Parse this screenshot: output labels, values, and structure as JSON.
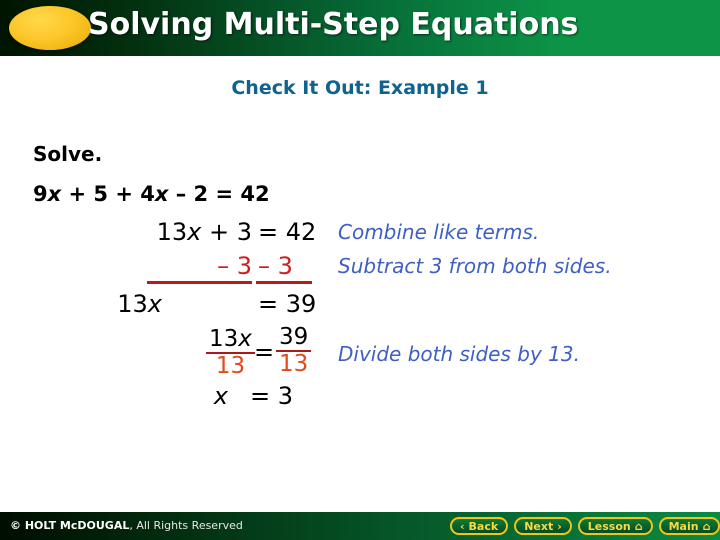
{
  "header": {
    "title": "Solving Multi-Step Equations",
    "ellipse_color": "#fcc72a",
    "gradient_from": "#001400",
    "gradient_to": "#0d9447"
  },
  "subtitle": "Check It Out: Example 1",
  "prompt": "Solve.",
  "equation_lines": [
    {
      "lhs": "9x + 5 + 4x – 2",
      "eq": "=",
      "rhs": "42",
      "note": ""
    },
    {
      "lhs": "13x + 3",
      "eq": "=",
      "rhs": "42",
      "note": "Combine like terms."
    },
    {
      "lhs": "– 3",
      "eq": "",
      "rhs": "– 3",
      "note": "Subtract 3 from both sides."
    },
    {
      "lhs": "13x",
      "eq": "=",
      "rhs": "39",
      "note": ""
    },
    {
      "lhs_num": "13x",
      "lhs_den": "13",
      "eq": "=",
      "rhs_num": "39",
      "rhs_den": "13",
      "note": "Divide both sides by 13."
    },
    {
      "lhs": "x",
      "eq": "=",
      "rhs": "3",
      "note": ""
    }
  ],
  "line1": {
    "a": "9",
    "x1": "x",
    "b": " + 5 + ",
    "c": "4",
    "x2": "x",
    "d": " – 2 = 42"
  },
  "line2": {
    "a": "13",
    "x1": "x",
    "b": " + 3",
    "eq": "= 42"
  },
  "line3": {
    "left": "– 3",
    "right": "– 3"
  },
  "line4": {
    "a": "13",
    "x1": "x",
    "eq": "= 39"
  },
  "line5": {
    "num_a": "13",
    "num_x": "x",
    "den": "13",
    "eq": "=",
    "rnum": "39",
    "rden": "13"
  },
  "line6": {
    "x": "x",
    "eq": "= 3"
  },
  "notes": {
    "combine": "Combine like terms.",
    "subtract": "Subtract 3 from both sides.",
    "divide": "Divide both sides by 13."
  },
  "footer": {
    "copyright_mark": "© HOLT McDOUGAL",
    "copyright_rest": ", All Rights Reserved",
    "buttons": [
      {
        "label": "Back",
        "icon": "chevron-left-icon",
        "glyph": "‹"
      },
      {
        "label": "Next",
        "icon": "chevron-right-icon",
        "glyph": "›"
      },
      {
        "label": "Lesson",
        "icon": "home-icon",
        "glyph": "⌂"
      },
      {
        "label": "Main",
        "icon": "home-icon",
        "glyph": "⌂"
      }
    ]
  },
  "colors": {
    "blue_note": "#3f5fc4",
    "red_step": "#cc2020",
    "red_orange": "#e2491d",
    "subtitle_teal": "#10638f",
    "header_green": "#0d9447",
    "button_gold": "#f0c419"
  }
}
